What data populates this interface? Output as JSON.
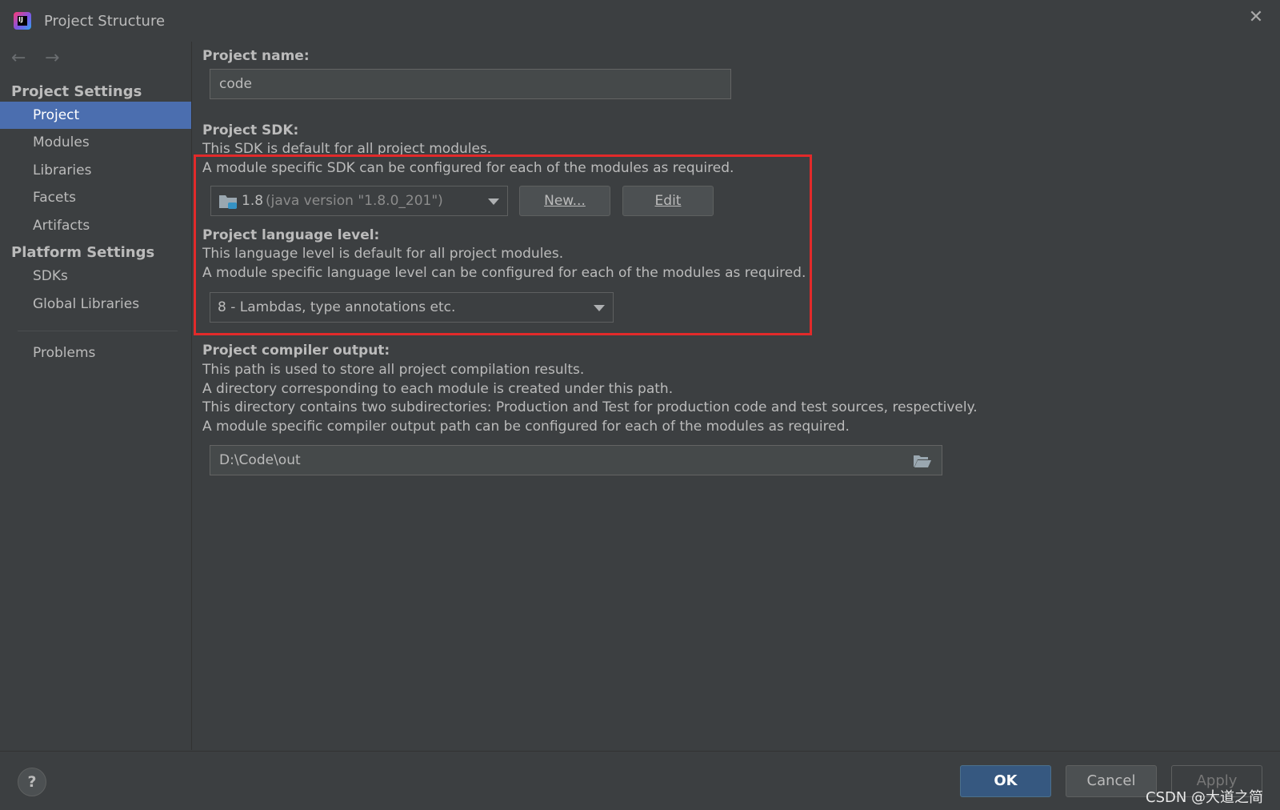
{
  "window": {
    "title": "Project Structure"
  },
  "sidebar": {
    "sections": [
      {
        "label": "Project Settings"
      },
      {
        "label": "Platform Settings"
      }
    ],
    "items": [
      {
        "label": "Project",
        "selected": true
      },
      {
        "label": "Modules"
      },
      {
        "label": "Libraries"
      },
      {
        "label": "Facets"
      },
      {
        "label": "Artifacts"
      },
      {
        "label": "SDKs"
      },
      {
        "label": "Global Libraries"
      },
      {
        "label": "Problems"
      }
    ]
  },
  "project": {
    "name_label": "Project name:",
    "name_value": "code",
    "sdk_label": "Project SDK:",
    "sdk_desc1": "This SDK is default for all project modules.",
    "sdk_desc2": "A module specific SDK can be configured for each of the modules as required.",
    "sdk_version": "1.8",
    "sdk_detail": "(java version \"1.8.0_201\")",
    "sdk_new_button": "New...",
    "sdk_edit_button": "Edit",
    "lang_label": "Project language level:",
    "lang_desc1": "This language level is default for all project modules.",
    "lang_desc2": "A module specific language level can be configured for each of the modules as required.",
    "lang_value": "8 - Lambdas, type annotations etc.",
    "output_label": "Project compiler output:",
    "output_desc1": "This path is used to store all project compilation results.",
    "output_desc2": "A directory corresponding to each module is created under this path.",
    "output_desc3": "This directory contains two subdirectories: Production and Test for production code and test sources, respectively.",
    "output_desc4": "A module specific compiler output path can be configured for each of the modules as required.",
    "output_value": "D:\\Code\\out"
  },
  "buttons": {
    "ok": "OK",
    "cancel": "Cancel",
    "apply": "Apply",
    "help": "?"
  },
  "watermark": "CSDN @大道之简",
  "colors": {
    "background": "#3c3f41",
    "selection": "#4b6eaf",
    "ok_button": "#365880",
    "highlight_box": "#e22a2a"
  },
  "icons": [
    "app-logo-icon",
    "close-icon",
    "back-arrow-icon",
    "forward-arrow-icon",
    "folder-icon",
    "chevron-down-icon",
    "folder-open-icon",
    "help-icon"
  ]
}
